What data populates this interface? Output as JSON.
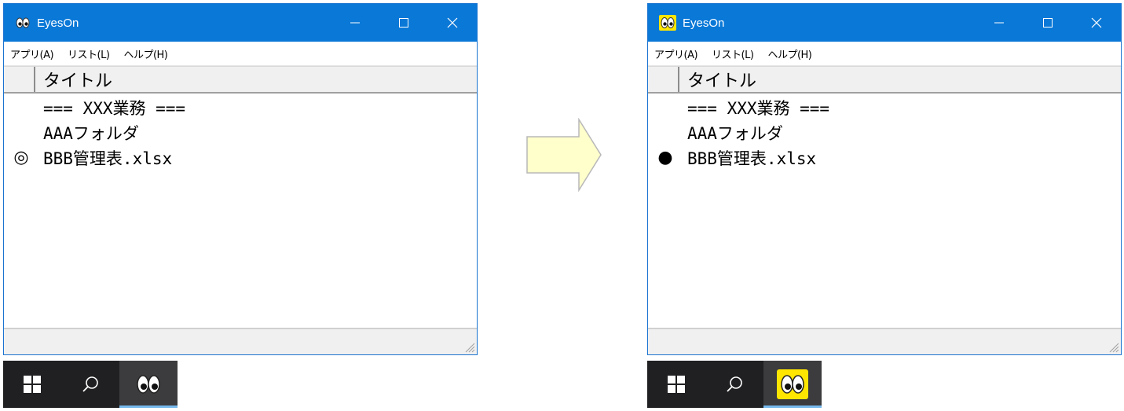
{
  "windows": [
    {
      "title": "EyesOn",
      "icon": "eyes-icon",
      "icon_highlighted": false,
      "menu": [
        "アプリ(A)",
        "リスト(L)",
        "ヘルプ(H)"
      ],
      "header_title": "タイトル",
      "rows": [
        {
          "mark": "",
          "text": "=== XXX業務 ==="
        },
        {
          "mark": "",
          "text": "AAAフォルダ"
        },
        {
          "mark": "◎",
          "text": "BBB管理表.xlsx"
        }
      ]
    },
    {
      "title": "EyesOn",
      "icon": "eyes-icon",
      "icon_highlighted": true,
      "menu": [
        "アプリ(A)",
        "リスト(L)",
        "ヘルプ(H)"
      ],
      "header_title": "タイトル",
      "rows": [
        {
          "mark": "",
          "text": "=== XXX業務 ==="
        },
        {
          "mark": "",
          "text": "AAAフォルダ"
        },
        {
          "mark": "●",
          "text": "BBB管理表.xlsx"
        }
      ]
    }
  ],
  "taskbars": [
    {
      "items": [
        "windows-start-icon",
        "search-icon",
        "eyes-icon"
      ],
      "eyes_highlighted": false
    },
    {
      "items": [
        "windows-start-icon",
        "search-icon",
        "eyes-icon"
      ],
      "eyes_highlighted": true
    }
  ],
  "colors": {
    "titlebar": "#0a78d7",
    "highlight": "#ffe600",
    "arrow_fill": "#ffffcc",
    "taskbar": "#202022"
  }
}
